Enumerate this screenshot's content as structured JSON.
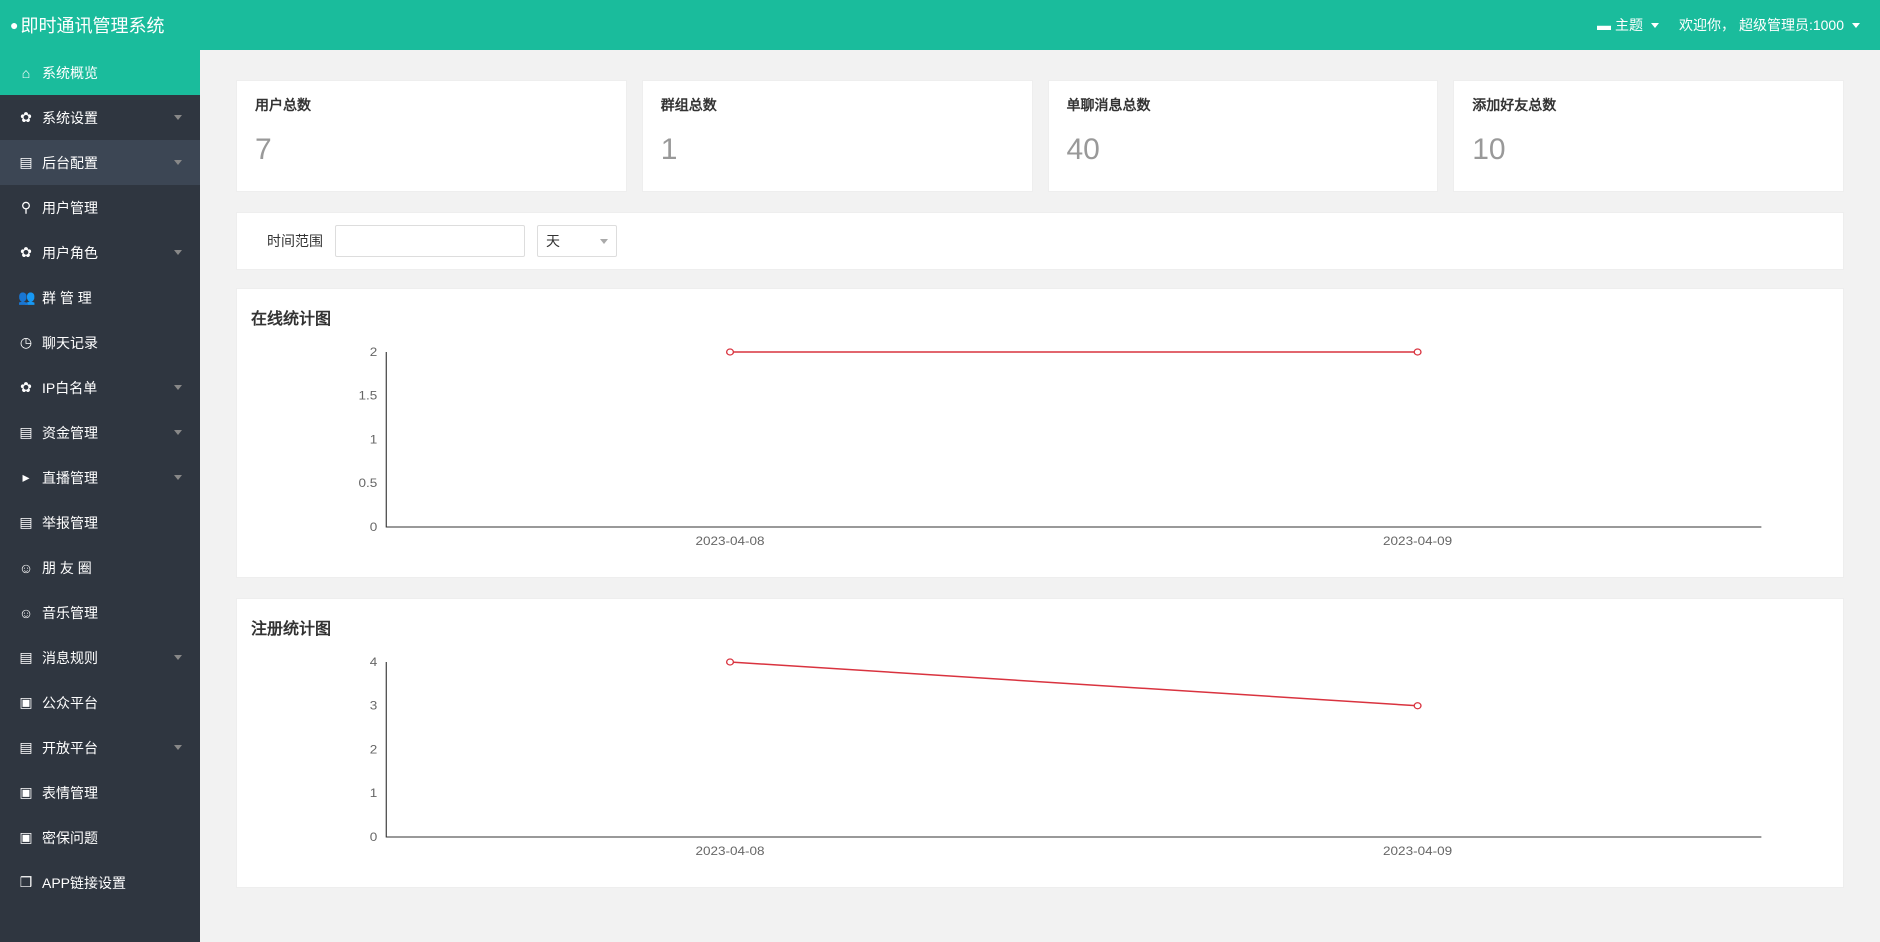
{
  "header": {
    "title": "即时通讯管理系统",
    "theme_label": "主题",
    "welcome_prefix": "欢迎你，",
    "user_label": "超级管理员:1000"
  },
  "sidebar": {
    "items": [
      {
        "id": "overview",
        "icon": "⌂",
        "label": "系统概览",
        "expandable": false,
        "active": true
      },
      {
        "id": "system-settings",
        "icon": "✿",
        "label": "系统设置",
        "expandable": true
      },
      {
        "id": "backend-config",
        "icon": "▤",
        "label": "后台配置",
        "expandable": true,
        "sub_active": true
      },
      {
        "id": "user-manage",
        "icon": "⚲",
        "label": "用户管理",
        "expandable": false
      },
      {
        "id": "user-role",
        "icon": "✿",
        "label": "用户角色",
        "expandable": true
      },
      {
        "id": "group-manage",
        "icon": "👥",
        "label": "群 管 理",
        "expandable": false
      },
      {
        "id": "chat-records",
        "icon": "◷",
        "label": "聊天记录",
        "expandable": false
      },
      {
        "id": "ip-whitelist",
        "icon": "✿",
        "label": "IP白名单",
        "expandable": true
      },
      {
        "id": "fund-manage",
        "icon": "▤",
        "label": "资金管理",
        "expandable": true
      },
      {
        "id": "live-manage",
        "icon": "▸",
        "label": "直播管理",
        "expandable": true
      },
      {
        "id": "report-manage",
        "icon": "▤",
        "label": "举报管理",
        "expandable": false
      },
      {
        "id": "moments",
        "icon": "☺",
        "label": "朋 友 圈",
        "expandable": false
      },
      {
        "id": "music-manage",
        "icon": "☺",
        "label": "音乐管理",
        "expandable": false
      },
      {
        "id": "message-rules",
        "icon": "▤",
        "label": "消息规则",
        "expandable": true
      },
      {
        "id": "public-platform",
        "icon": "▣",
        "label": "公众平台",
        "expandable": false
      },
      {
        "id": "open-platform",
        "icon": "▤",
        "label": "开放平台",
        "expandable": true
      },
      {
        "id": "emoji-manage",
        "icon": "▣",
        "label": "表情管理",
        "expandable": false
      },
      {
        "id": "security-question",
        "icon": "▣",
        "label": "密保问题",
        "expandable": false
      },
      {
        "id": "app-link-setting",
        "icon": "❒",
        "label": "APP链接设置",
        "expandable": false
      }
    ]
  },
  "stats": [
    {
      "title": "用户总数",
      "value": "7"
    },
    {
      "title": "群组总数",
      "value": "1"
    },
    {
      "title": "单聊消息总数",
      "value": "40"
    },
    {
      "title": "添加好友总数",
      "value": "10"
    }
  ],
  "filter": {
    "label": "时间范围",
    "input_value": "",
    "select_value": "天"
  },
  "charts": {
    "online": {
      "title": "在线统计图"
    },
    "register": {
      "title": "注册统计图"
    }
  },
  "chart_data": [
    {
      "type": "line",
      "title": "在线统计图",
      "categories": [
        "2023-04-08",
        "2023-04-09"
      ],
      "values": [
        2,
        2
      ],
      "ylim": [
        0,
        2
      ],
      "yticks": [
        0,
        0.5,
        1,
        1.5,
        2
      ],
      "xlabel": "",
      "ylabel": ""
    },
    {
      "type": "line",
      "title": "注册统计图",
      "categories": [
        "2023-04-08",
        "2023-04-09"
      ],
      "values": [
        4,
        3
      ],
      "ylim": [
        0,
        4
      ],
      "yticks": [
        0,
        1,
        2,
        3,
        4
      ],
      "xlabel": "",
      "ylabel": ""
    }
  ]
}
